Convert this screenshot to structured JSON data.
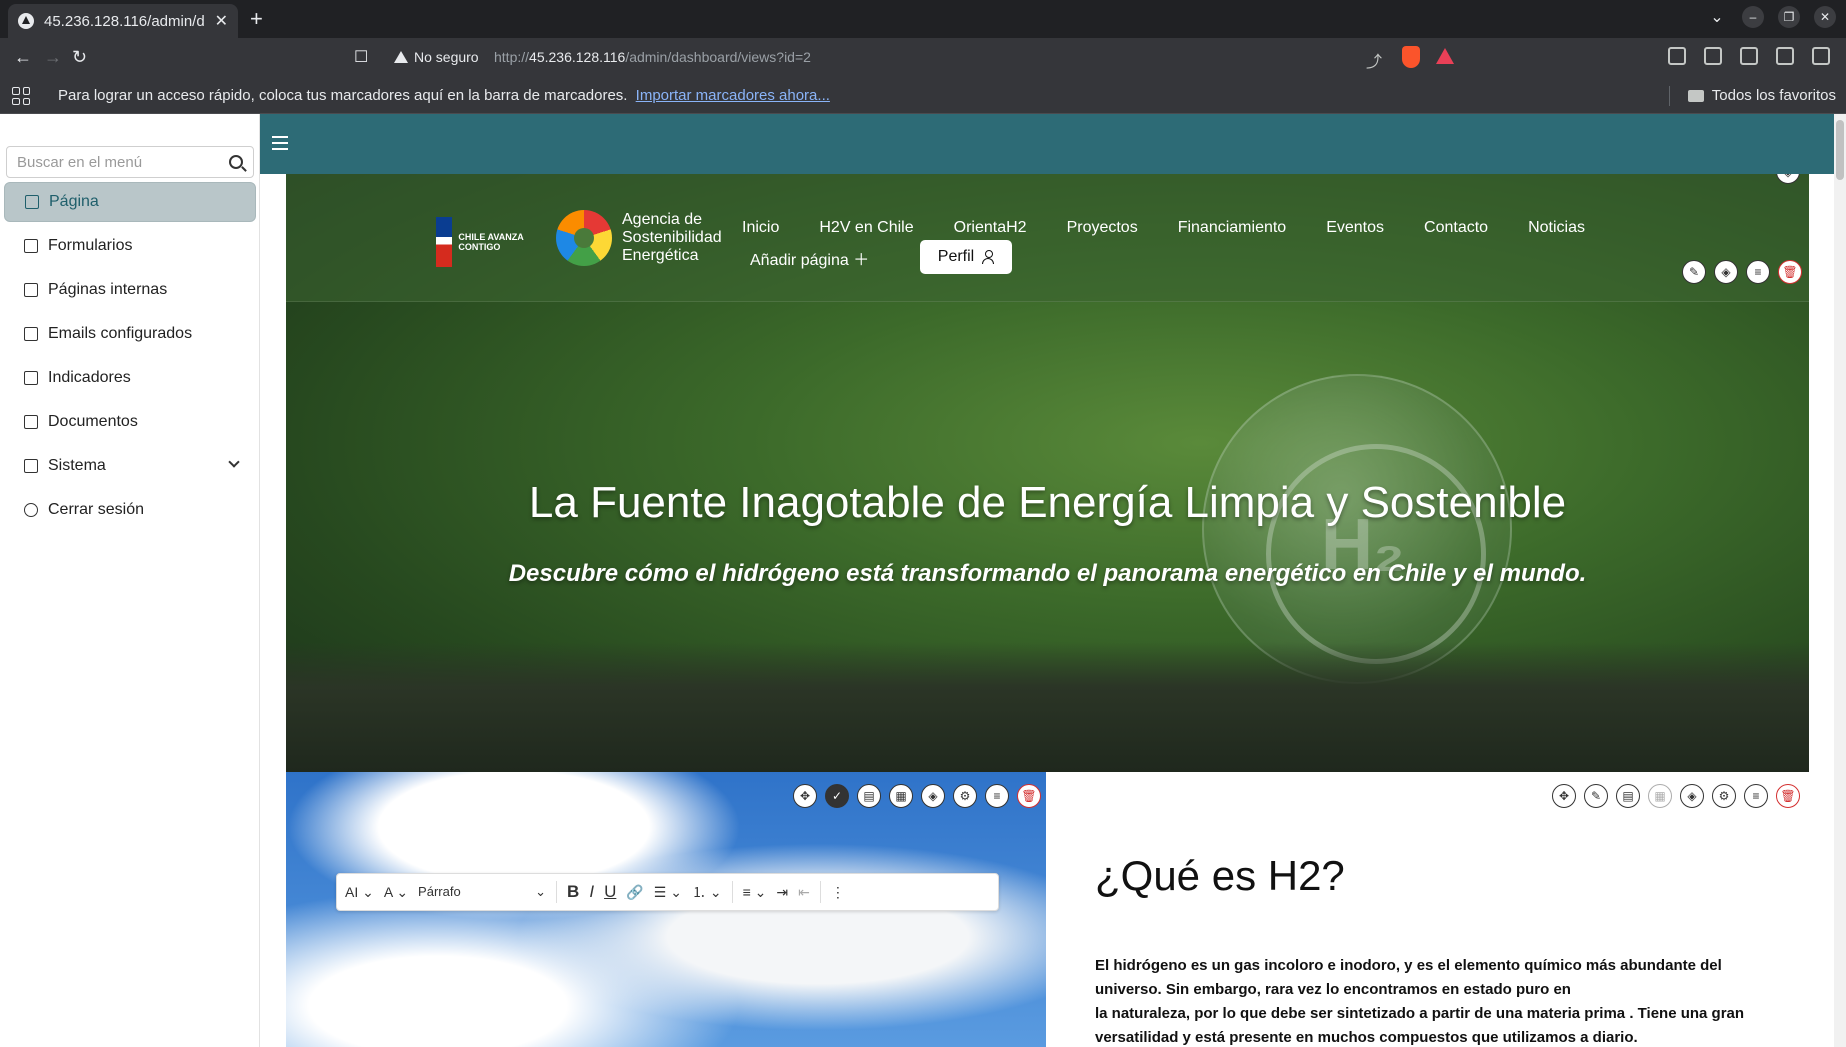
{
  "browser": {
    "tab_title": "45.236.128.116/admin/d",
    "security_label": "No seguro",
    "url_prefix": "http://",
    "url_host": "45.236.128.116",
    "url_path": "/admin/dashboard/views?id=2",
    "bookmarks_prompt": "Para lograr un acceso rápido, coloca tus marcadores aquí en la barra de marcadores.",
    "bookmarks_link": "Importar marcadores ahora...",
    "all_favorites": "Todos los favoritos"
  },
  "sidebar": {
    "search_placeholder": "Buscar en el menú",
    "items": [
      {
        "label": "Página",
        "icon": "chart-icon",
        "active": true
      },
      {
        "label": "Formularios",
        "icon": "edit-icon"
      },
      {
        "label": "Páginas internas",
        "icon": "pages-icon"
      },
      {
        "label": "Emails configurados",
        "icon": "mail-icon"
      },
      {
        "label": "Indicadores",
        "icon": "document-icon"
      },
      {
        "label": "Documentos",
        "icon": "document-icon"
      },
      {
        "label": "Sistema",
        "icon": "chart-icon"
      },
      {
        "label": "Cerrar sesión",
        "icon": "logout-icon"
      }
    ]
  },
  "site": {
    "logo1_text": "CHILE AVANZA CONTIGO",
    "logo2_lines": [
      "Agencia de",
      "Sostenibilidad",
      "Energética"
    ],
    "nav": [
      "Inicio",
      "H2V en Chile",
      "OrientaH2",
      "Proyectos",
      "Financiamiento",
      "Eventos",
      "Contacto",
      "Noticias"
    ],
    "add_page": "Añadir página",
    "profile": "Perfil",
    "hero_title": "La Fuente Inagotable de  Energía Limpia y Sostenible",
    "hero_subtitle": "Descubre cómo el hidrógeno  está transformando el panorama energético en Chile y el mundo.",
    "section_title": "¿Qué es H2?",
    "section_text_1": "El hidrógeno es un gas incoloro e inodoro, y es el elemento químico más abundante del universo. Sin embargo, rara vez lo encontramos en estado puro en",
    "section_text_2": "la naturaleza, por lo que debe ser sintetizado a partir de una materia prima . Tiene una gran versatilidad y  está presente en muchos compuestos que utilizamos a diario."
  },
  "editor": {
    "paragraph_select": "Párrafo"
  },
  "colors": {
    "teal": "#2d6b76",
    "active_bg": "#b9c6c9"
  }
}
